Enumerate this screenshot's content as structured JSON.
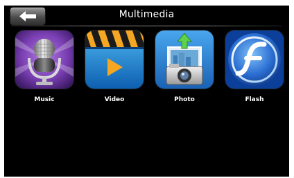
{
  "header": {
    "title": "Multimedia",
    "back_icon": "left-arrow-icon"
  },
  "apps": [
    {
      "label": "Music",
      "icon": "microphone-icon"
    },
    {
      "label": "Video",
      "icon": "clapperboard-play-icon"
    },
    {
      "label": "Photo",
      "icon": "camera-upload-icon"
    },
    {
      "label": "Flash",
      "icon": "flash-logo-icon"
    }
  ],
  "colors": {
    "background": "#000000",
    "music_purple": "#7a3fb3",
    "video_blue": "#1e84d8",
    "play_orange": "#f5a623",
    "photo_blue": "#2f86d6",
    "flash_blue": "#2b6ed2"
  }
}
